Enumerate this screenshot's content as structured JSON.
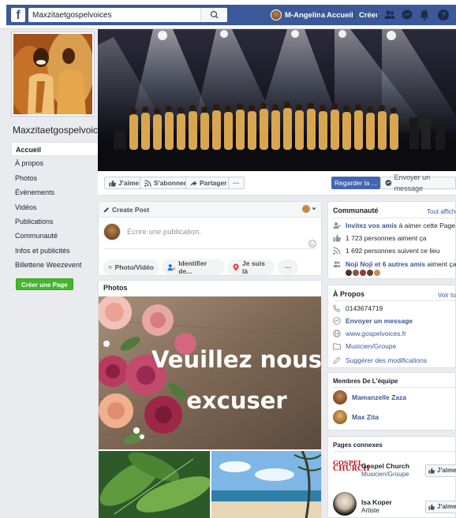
{
  "topbar": {
    "logo": "f",
    "search_value": "Maxzitaetgospelvoices",
    "user_name": "M-Angelina",
    "home_label": "Accueil",
    "create_label": "Créer"
  },
  "sidebar": {
    "page_name": "Maxzitaetgospelvoices",
    "items": [
      {
        "label": "Accueil",
        "active": true
      },
      {
        "label": "À propos"
      },
      {
        "label": "Photos"
      },
      {
        "label": "Évènements"
      },
      {
        "label": "Vidéos"
      },
      {
        "label": "Publications"
      },
      {
        "label": "Communauté"
      },
      {
        "label": "Infos et publicités"
      },
      {
        "label": "Billetterie Weezevent"
      }
    ],
    "create_page_label": "Créer une Page"
  },
  "actions": {
    "like": "J'aime",
    "follow": "S'abonner",
    "share": "Partager",
    "more": "···",
    "watch": "Regarder la ...",
    "message": "Envoyer un message"
  },
  "create_post": {
    "title": "Create Post",
    "placeholder": "Écrire une publication.",
    "photo_video": "Photo/Vidéo",
    "tag": "Identifier de...",
    "checkin": "Je suis là",
    "more": "···"
  },
  "photos": {
    "title": "Photos",
    "main_text_line1": "Veuillez nous",
    "main_text_line2": "excuser"
  },
  "community": {
    "title": "Communauté",
    "see_all": "Tout afficher",
    "invite_link": "Invitez vos amis",
    "invite_rest": "à aimer cette Page",
    "likes": "1 723 personnes aiment ça",
    "follows": "1 692 personnes suivent ce lieu",
    "friends_link": "Noji Noji et 6 autres amis",
    "friends_rest": "aiment ça"
  },
  "about": {
    "title": "À Propos",
    "see_all": "Voir tout",
    "phone": "0143674719",
    "message": "Envoyer un message",
    "website": "www.gospelvoices.fr",
    "category": "Musicien/Groupe",
    "suggest": "Suggérer des modifications"
  },
  "team": {
    "title": "Membres De L'équipe",
    "members": [
      "Mamanzelle Zaza",
      "Max Zita"
    ]
  },
  "related": {
    "title": "Pages connexes",
    "pages": [
      {
        "name": "Gospel Church",
        "sub": "Musicien/Groupe",
        "like": "J'aime"
      },
      {
        "name": "Isa Koper",
        "sub": "Artiste",
        "like": "J'aime"
      }
    ],
    "logo_text1": "GOSPEL",
    "logo_text2": "CHURCH"
  },
  "colors": {
    "fb_blue": "#3b5998",
    "link": "#365899",
    "green": "#42b72a",
    "button_blue": "#4267b2"
  }
}
